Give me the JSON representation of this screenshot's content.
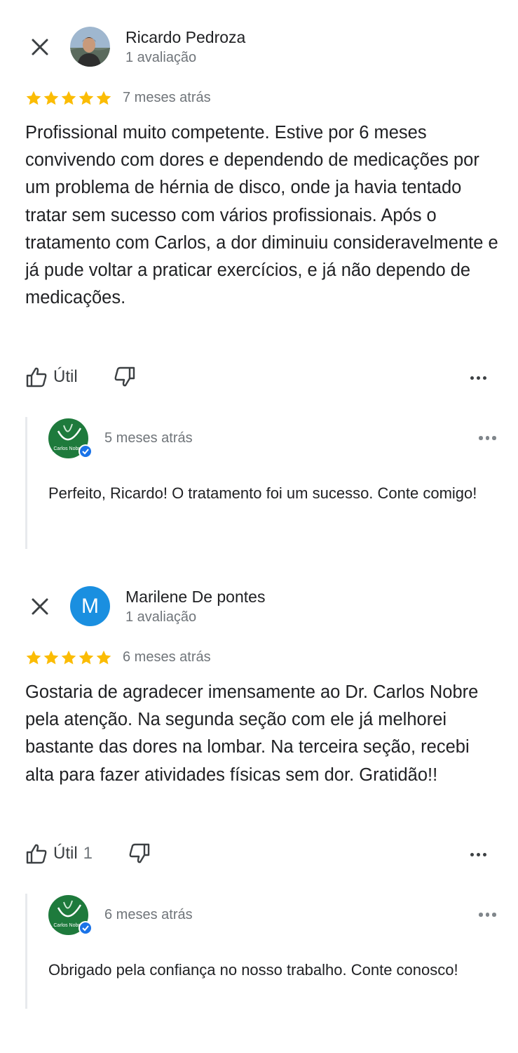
{
  "reviews": [
    {
      "reviewer_name": "Ricardo Pedroza",
      "review_count": "1 avaliação",
      "rating": 5,
      "date": "7 meses atrás",
      "text": "Profissional muito competente. Estive por 6 meses convivendo com dores e dependendo de medicações por um problema de hérnia de disco, onde ja havia tentado tratar sem sucesso com vários profissionais. Após o tratamento com Carlos, a dor diminuiu consideravelmente e já pude voltar a praticar exercícios, e já não dependo de medicações.",
      "helpful_label": "Útil",
      "helpful_count": "",
      "avatar_type": "photo",
      "reply": {
        "owner_logo_text": "Carlos Nobre",
        "date": "5 meses atrás",
        "text": "Perfeito, Ricardo! O tratamento foi um sucesso. Conte comigo!"
      }
    },
    {
      "reviewer_name": "Marilene De pontes",
      "review_count": "1 avaliação",
      "rating": 5,
      "date": "6 meses atrás",
      "text": "Gostaria de agradecer imensamente ao Dr. Carlos Nobre pela atenção. Na segunda seção com ele já melhorei bastante das dores na lombar. Na terceira seção, recebi alta para fazer atividades físicas sem dor. Gratidão!!",
      "helpful_label": "Útil",
      "helpful_count": "1",
      "avatar_type": "initial",
      "avatar_initial": "M",
      "reply": {
        "owner_logo_text": "Carlos Nobre",
        "date": "6 meses atrás",
        "text": "Obrigado pela confiança no nosso trabalho. Conte conosco!"
      }
    }
  ],
  "colors": {
    "star": "#fbbc04",
    "avatar_initial_bg": "#1a8fe0",
    "owner_logo_green": "#1e7a3c",
    "verified_badge": "#1a73e8",
    "reply_border": "#e8eaed"
  },
  "icons": [
    "close-icon",
    "star-icon",
    "thumbs-up-icon",
    "thumbs-down-icon",
    "more-horiz-icon",
    "verified-check-icon"
  ]
}
